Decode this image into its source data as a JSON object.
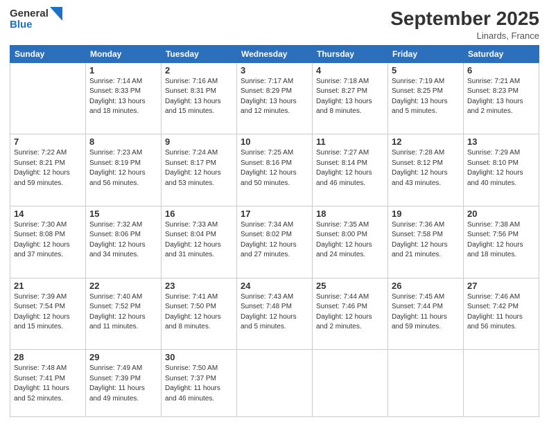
{
  "header": {
    "logo_line1": "General",
    "logo_line2": "Blue",
    "main_title": "September 2025",
    "subtitle": "Linards, France"
  },
  "columns": [
    "Sunday",
    "Monday",
    "Tuesday",
    "Wednesday",
    "Thursday",
    "Friday",
    "Saturday"
  ],
  "weeks": [
    [
      {
        "day": "",
        "info": ""
      },
      {
        "day": "1",
        "info": "Sunrise: 7:14 AM\nSunset: 8:33 PM\nDaylight: 13 hours\nand 18 minutes."
      },
      {
        "day": "2",
        "info": "Sunrise: 7:16 AM\nSunset: 8:31 PM\nDaylight: 13 hours\nand 15 minutes."
      },
      {
        "day": "3",
        "info": "Sunrise: 7:17 AM\nSunset: 8:29 PM\nDaylight: 13 hours\nand 12 minutes."
      },
      {
        "day": "4",
        "info": "Sunrise: 7:18 AM\nSunset: 8:27 PM\nDaylight: 13 hours\nand 8 minutes."
      },
      {
        "day": "5",
        "info": "Sunrise: 7:19 AM\nSunset: 8:25 PM\nDaylight: 13 hours\nand 5 minutes."
      },
      {
        "day": "6",
        "info": "Sunrise: 7:21 AM\nSunset: 8:23 PM\nDaylight: 13 hours\nand 2 minutes."
      }
    ],
    [
      {
        "day": "7",
        "info": "Sunrise: 7:22 AM\nSunset: 8:21 PM\nDaylight: 12 hours\nand 59 minutes."
      },
      {
        "day": "8",
        "info": "Sunrise: 7:23 AM\nSunset: 8:19 PM\nDaylight: 12 hours\nand 56 minutes."
      },
      {
        "day": "9",
        "info": "Sunrise: 7:24 AM\nSunset: 8:17 PM\nDaylight: 12 hours\nand 53 minutes."
      },
      {
        "day": "10",
        "info": "Sunrise: 7:25 AM\nSunset: 8:16 PM\nDaylight: 12 hours\nand 50 minutes."
      },
      {
        "day": "11",
        "info": "Sunrise: 7:27 AM\nSunset: 8:14 PM\nDaylight: 12 hours\nand 46 minutes."
      },
      {
        "day": "12",
        "info": "Sunrise: 7:28 AM\nSunset: 8:12 PM\nDaylight: 12 hours\nand 43 minutes."
      },
      {
        "day": "13",
        "info": "Sunrise: 7:29 AM\nSunset: 8:10 PM\nDaylight: 12 hours\nand 40 minutes."
      }
    ],
    [
      {
        "day": "14",
        "info": "Sunrise: 7:30 AM\nSunset: 8:08 PM\nDaylight: 12 hours\nand 37 minutes."
      },
      {
        "day": "15",
        "info": "Sunrise: 7:32 AM\nSunset: 8:06 PM\nDaylight: 12 hours\nand 34 minutes."
      },
      {
        "day": "16",
        "info": "Sunrise: 7:33 AM\nSunset: 8:04 PM\nDaylight: 12 hours\nand 31 minutes."
      },
      {
        "day": "17",
        "info": "Sunrise: 7:34 AM\nSunset: 8:02 PM\nDaylight: 12 hours\nand 27 minutes."
      },
      {
        "day": "18",
        "info": "Sunrise: 7:35 AM\nSunset: 8:00 PM\nDaylight: 12 hours\nand 24 minutes."
      },
      {
        "day": "19",
        "info": "Sunrise: 7:36 AM\nSunset: 7:58 PM\nDaylight: 12 hours\nand 21 minutes."
      },
      {
        "day": "20",
        "info": "Sunrise: 7:38 AM\nSunset: 7:56 PM\nDaylight: 12 hours\nand 18 minutes."
      }
    ],
    [
      {
        "day": "21",
        "info": "Sunrise: 7:39 AM\nSunset: 7:54 PM\nDaylight: 12 hours\nand 15 minutes."
      },
      {
        "day": "22",
        "info": "Sunrise: 7:40 AM\nSunset: 7:52 PM\nDaylight: 12 hours\nand 11 minutes."
      },
      {
        "day": "23",
        "info": "Sunrise: 7:41 AM\nSunset: 7:50 PM\nDaylight: 12 hours\nand 8 minutes."
      },
      {
        "day": "24",
        "info": "Sunrise: 7:43 AM\nSunset: 7:48 PM\nDaylight: 12 hours\nand 5 minutes."
      },
      {
        "day": "25",
        "info": "Sunrise: 7:44 AM\nSunset: 7:46 PM\nDaylight: 12 hours\nand 2 minutes."
      },
      {
        "day": "26",
        "info": "Sunrise: 7:45 AM\nSunset: 7:44 PM\nDaylight: 11 hours\nand 59 minutes."
      },
      {
        "day": "27",
        "info": "Sunrise: 7:46 AM\nSunset: 7:42 PM\nDaylight: 11 hours\nand 56 minutes."
      }
    ],
    [
      {
        "day": "28",
        "info": "Sunrise: 7:48 AM\nSunset: 7:41 PM\nDaylight: 11 hours\nand 52 minutes."
      },
      {
        "day": "29",
        "info": "Sunrise: 7:49 AM\nSunset: 7:39 PM\nDaylight: 11 hours\nand 49 minutes."
      },
      {
        "day": "30",
        "info": "Sunrise: 7:50 AM\nSunset: 7:37 PM\nDaylight: 11 hours\nand 46 minutes."
      },
      {
        "day": "",
        "info": ""
      },
      {
        "day": "",
        "info": ""
      },
      {
        "day": "",
        "info": ""
      },
      {
        "day": "",
        "info": ""
      }
    ]
  ]
}
